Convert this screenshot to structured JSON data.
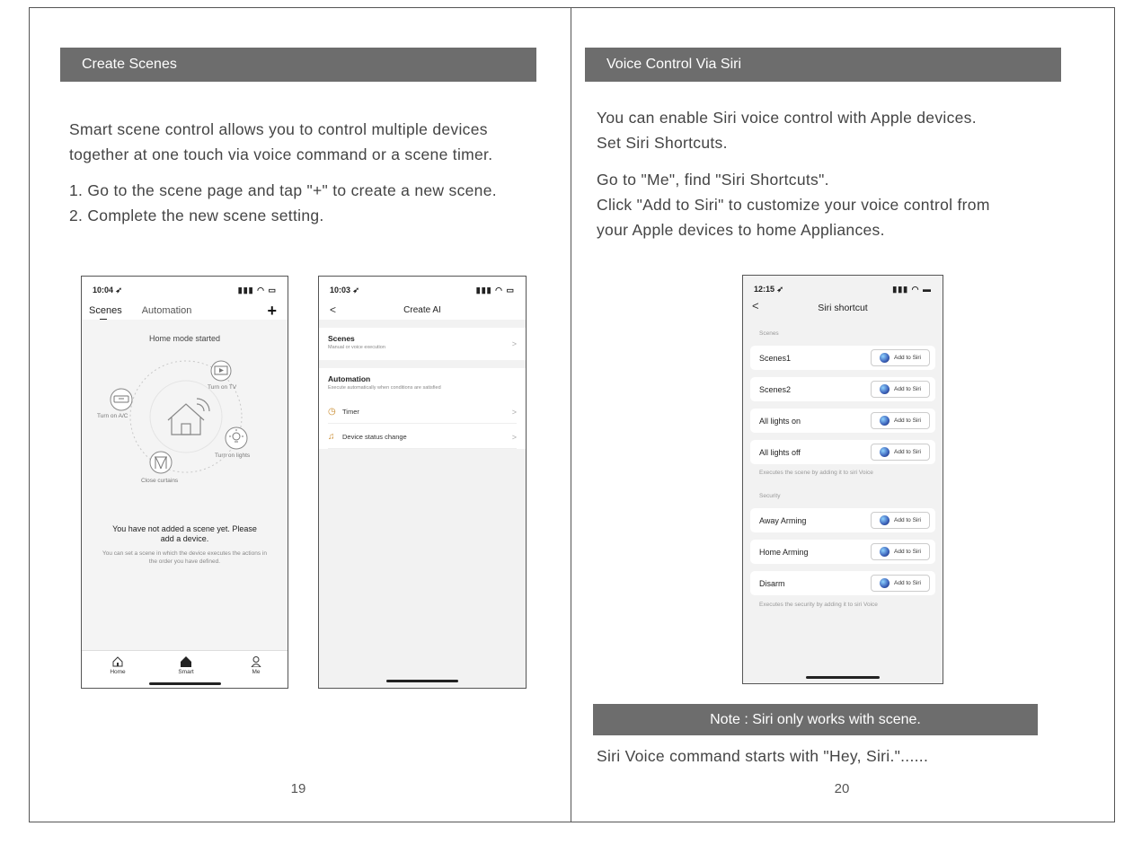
{
  "left_page": {
    "banner": "Create Scenes",
    "intro_line1": "Smart scene control allows you to control multiple devices",
    "intro_line2": "together at one touch via voice command or a scene timer.",
    "step1": "1. Go to the scene page and tap \"+\" to create a new scene.",
    "step2": "2. Complete the new scene setting.",
    "page_number": "19"
  },
  "phone1": {
    "time": "10:04",
    "tab_scenes": "Scenes",
    "tab_automation": "Automation",
    "add": "+",
    "title": "Home mode started",
    "labels": {
      "tv": "Turn on TV",
      "ac": "Turn on A/C",
      "lights": "Turn on lights",
      "curtains": "Close curtains"
    },
    "message": "You have not added a scene yet. Please add a device.",
    "sub": "You can set a scene in which the device executes the actions in the order you have defined.",
    "nav": {
      "home": "Home",
      "smart": "Smart",
      "me": "Me"
    }
  },
  "phone2": {
    "time": "10:03",
    "back": "<",
    "title": "Create AI",
    "scenes_title": "Scenes",
    "scenes_sub": "Manual or voice execution",
    "automation_title": "Automation",
    "automation_sub": "Execute automatically when conditions are satisfied",
    "timer": "Timer",
    "device_status": "Device status change",
    "chevron": ">"
  },
  "right_page": {
    "banner": "Voice Control Via Siri",
    "para1_line1": "You can enable Siri voice control with Apple devices.",
    "para1_line2": "Set Siri Shortcuts.",
    "para2_line1": "Go to \"Me\", find \"Siri Shortcuts\".",
    "para2_line2": "Click \"Add to Siri\" to customize your voice control from",
    "para2_line3": "your Apple devices to home Appliances.",
    "note": "Note : Siri  only works with scene.",
    "footer": "Siri Voice command starts with \"Hey, Siri.\"......",
    "page_number": "20"
  },
  "phone3": {
    "time": "12:15",
    "back": "<",
    "title": "Siri shortcut",
    "section_scenes": "Scenes",
    "section_security": "Security",
    "add_label": "Add to Siri",
    "scene_rows": [
      "Scenes1",
      "Scenes2",
      "All lights on",
      "All lights off"
    ],
    "scene_note": "Executes the scene by adding it to siri Voice",
    "security_rows": [
      "Away Arming",
      "Home Arming",
      "Disarm"
    ],
    "security_note": "Executes the security by adding it to siri Voice"
  },
  "colors": {
    "banner": "#6d6d6d",
    "border": "#555555"
  }
}
